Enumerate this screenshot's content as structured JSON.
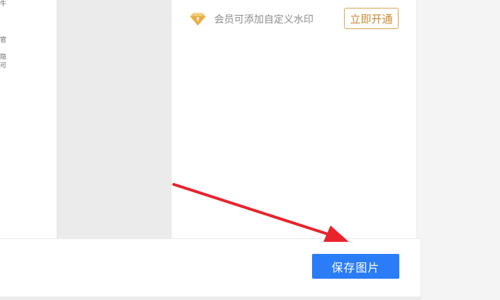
{
  "left_fragments": [
    "牛",
    "官",
    "隐",
    "可"
  ],
  "watermark": {
    "icon": "diamond-icon",
    "text": "会员可添加自定义水印",
    "button_label": "立即开通"
  },
  "footer": {
    "save_label": "保存图片"
  },
  "colors": {
    "accent_blue": "#2a7cf7",
    "gold": "#d9a252",
    "arrow": "#e8232b"
  }
}
